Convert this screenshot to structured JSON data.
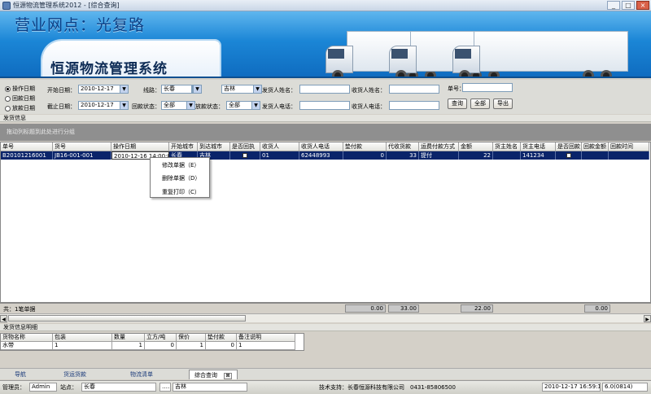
{
  "window": {
    "title": "恒源物流管理系统2012 - [综合查询]"
  },
  "banner": {
    "branch": "营业网点：光复路",
    "system_name": "恒源物流管理系统"
  },
  "filters": {
    "date_modes": [
      {
        "label": "操作日期",
        "selected": true
      },
      {
        "label": "回款日期",
        "selected": false
      },
      {
        "label": "放款日期",
        "selected": false
      }
    ],
    "start_date_label": "开始日期：",
    "start_date": "2010-12-17",
    "end_date_label": "截止日期：",
    "end_date": "2010-12-17",
    "route_label": "线路：",
    "route_value": "长春",
    "route_dest": "吉林",
    "payback_status_label": "回款状态：",
    "payback_status": "全部",
    "release_status_label": "放款状态：",
    "release_status": "全部",
    "sender_name_label": "发货人姓名：",
    "sender_phone_label": "发货人电话：",
    "receiver_name_label": "收货人姓名：",
    "receiver_phone_label": "收货人电话：",
    "waybill_label": "单号：",
    "buttons": {
      "query": "查询",
      "all": "全部",
      "export": "导出"
    }
  },
  "shipment_section": {
    "title": "发货信息",
    "group_hint": "拖动列标题到此处进行分组"
  },
  "grid": {
    "columns": [
      "单号",
      "货号",
      "操作日期",
      "开始城市",
      "到达城市",
      "是否回执",
      "收货人",
      "收货人电话",
      "垫付款",
      "代收货款",
      "运费付款方式",
      "金额",
      "货主姓名",
      "货主电话",
      "是否回款",
      "回款金额",
      "回款时间"
    ],
    "rows": [
      {
        "waybill": "B20101216001",
        "goods_no": "JB16-001-001",
        "op_date": "2010-12-16 14:00:05",
        "from_city": "长春",
        "to_city": "吉林",
        "receipt": false,
        "receiver": "01",
        "receiver_phone": "62448993",
        "advance": "0",
        "collect": "33",
        "pay_method": "提付",
        "amount": "22",
        "owner_name": "",
        "owner_phone": "141234",
        "paid_back": false,
        "payback_amount": "",
        "payback_time": ""
      }
    ],
    "footer": {
      "count": "共：1笔单据",
      "advance_total": "0.00",
      "collect_total": "33.00",
      "amount_total": "22.00",
      "payback_total": "0.00"
    }
  },
  "context_menu": {
    "items": [
      "修改单据（E）",
      "删除单据（D）",
      "重复打印（C）"
    ]
  },
  "detail_section": {
    "title": "发货信息明细",
    "columns": [
      "货物名称",
      "包装",
      "数量",
      "立方/吨",
      "保价",
      "垫付款",
      "备注说明"
    ],
    "rows": [
      {
        "name": "水带",
        "pack": "1",
        "qty": "1",
        "volume": "0",
        "insured": "1",
        "advance": "0",
        "note": "1"
      }
    ]
  },
  "tabs": [
    {
      "label": "导航",
      "active": false
    },
    {
      "label": "货运货款",
      "active": false
    },
    {
      "label": "物流清单",
      "active": false
    },
    {
      "label": "综合查询",
      "active": true
    }
  ],
  "status": {
    "operator_label": "管理员：",
    "operator": "Admin",
    "station_label": "站点：",
    "station": "长春",
    "dest_prefix": "……",
    "dest": "吉林",
    "support": "技术支持：长春恒源科技有限公司　0431-85806500",
    "datetime": "2010-12-17 16:59:18",
    "version": "6.0(0814)"
  }
}
